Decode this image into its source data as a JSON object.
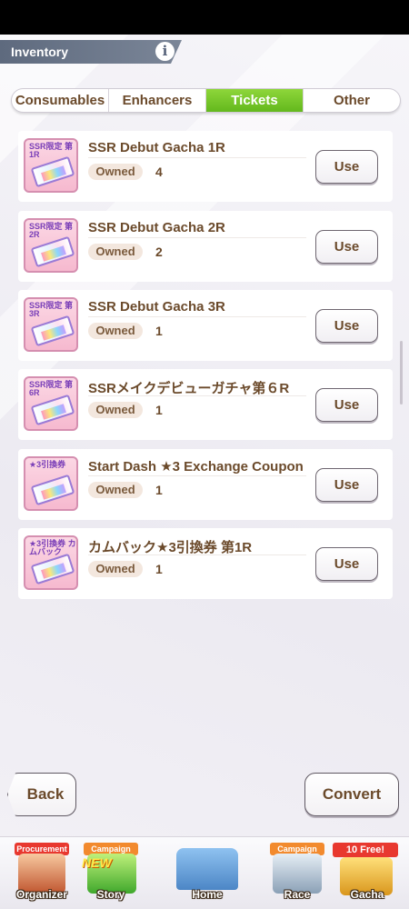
{
  "header": {
    "title": "Inventory",
    "info_icon": "i"
  },
  "tabs": [
    {
      "label": "Consumables",
      "active": false
    },
    {
      "label": "Enhancers",
      "active": false
    },
    {
      "label": "Tickets",
      "active": true
    },
    {
      "label": "Other",
      "active": false
    }
  ],
  "owned_label": "Owned",
  "use_label": "Use",
  "items": [
    {
      "name": "SSR Debut Gacha 1R",
      "count": "4",
      "icon_text": "SSR限定 第1R"
    },
    {
      "name": "SSR Debut Gacha 2R",
      "count": "2",
      "icon_text": "SSR限定 第2R"
    },
    {
      "name": "SSR Debut Gacha 3R",
      "count": "1",
      "icon_text": "SSR限定 第3R"
    },
    {
      "name": "SSRメイクデビューガチャ第６R",
      "count": "1",
      "icon_text": "SSR限定 第6R"
    },
    {
      "name": "Start Dash ★3 Exchange Coupon",
      "count": "1",
      "icon_text": "★3引換券"
    },
    {
      "name": "カムバック★3引換券 第1R",
      "count": "1",
      "icon_text": "★3引換券 カムバック"
    }
  ],
  "footer": {
    "back_label": "Back",
    "convert_label": "Convert"
  },
  "nav": {
    "organizer": {
      "label": "Organizer",
      "tag": "Procurement"
    },
    "story": {
      "label": "Story",
      "tag": "Campaign",
      "badge": "NEW"
    },
    "home": {
      "label": "Home"
    },
    "race": {
      "label": "Race",
      "tag": "Campaign"
    },
    "gacha": {
      "label": "Gacha",
      "tag": "10 Free!"
    }
  },
  "colors": {
    "accent_green": "#76c42a",
    "text_brown": "#6b4a2b",
    "ticket_pink": "#f6b9cf",
    "campaign_orange": "#f28a2e",
    "gacha_red": "#e8382f"
  }
}
